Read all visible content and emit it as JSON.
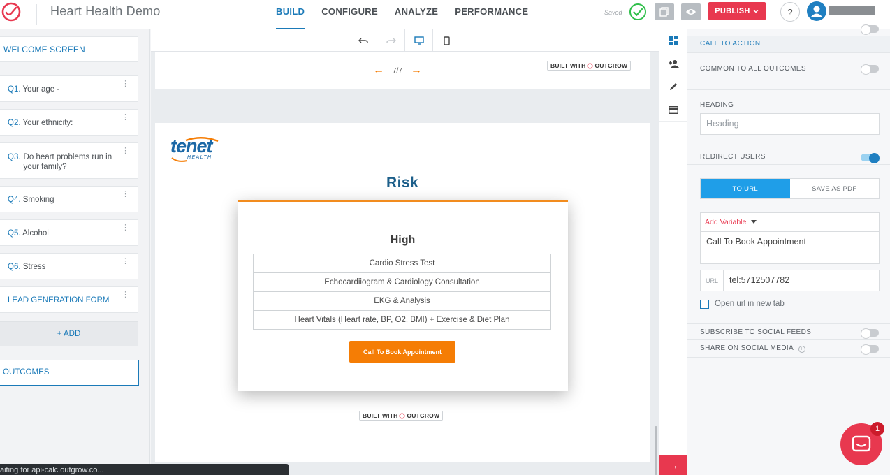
{
  "header": {
    "app_title": "Heart Health Demo",
    "nav": [
      "BUILD",
      "CONFIGURE",
      "ANALYZE",
      "PERFORMANCE"
    ],
    "active_nav": "BUILD",
    "saved_text": "Saved",
    "publish_label": "PUBLISH",
    "help_label": "?"
  },
  "sidebar": {
    "welcome": "WELCOME SCREEN",
    "questions": [
      {
        "no": "Q1.",
        "text": "Your age -"
      },
      {
        "no": "Q2.",
        "text": "Your ethnicity:"
      },
      {
        "no": "Q3.",
        "text": "Do heart problems run in your family?"
      },
      {
        "no": "Q4.",
        "text": "Smoking"
      },
      {
        "no": "Q5.",
        "text": "Alcohol"
      },
      {
        "no": "Q6.",
        "text": "Stress"
      }
    ],
    "lead_form": "LEAD GENERATION FORM",
    "add_label": "+ ADD",
    "outcomes": "OUTCOMES"
  },
  "canvas": {
    "pager": "7/7",
    "built_with": "BUILT WITH",
    "outgrow": "OUTGROW",
    "brand_name": "tenet",
    "brand_sub": "HEALTH",
    "outcome_title": "Risk",
    "risk_level": "High",
    "recommendations": [
      "Cardio Stress Test",
      "Echocardiiogram & Cardiology Consultation",
      "EKG & Analysis",
      "Heart Vitals (Heart rate, BP, O2, BMI) + Exercise & Diet Plan"
    ],
    "cta_label": "Call To Book Appointment",
    "status_text": "aiting for api-calc.outgrow.co..."
  },
  "props": {
    "call_to_action": "CALL TO ACTION",
    "common_outcomes": "COMMON TO ALL OUTCOMES",
    "heading_label": "HEADING",
    "heading_placeholder": "Heading",
    "redirect_users": "REDIRECT USERS",
    "tab_url": "TO URL",
    "tab_pdf": "SAVE AS PDF",
    "add_variable": "Add Variable",
    "button_text": "Call To Book Appointment",
    "url_label": "URL",
    "url_value": "tel:5712507782",
    "open_new_tab": "Open url in new tab",
    "subscribe_feeds": "SUBSCRIBE TO SOCIAL FEEDS",
    "share_social": "SHARE ON SOCIAL MEDIA",
    "chat_badge": "1"
  },
  "colors": {
    "brand_blue": "#1b7ab8",
    "accent_red": "#e8384f",
    "cta_orange": "#f57d05",
    "toggle_blue": "#1f9ee8"
  }
}
